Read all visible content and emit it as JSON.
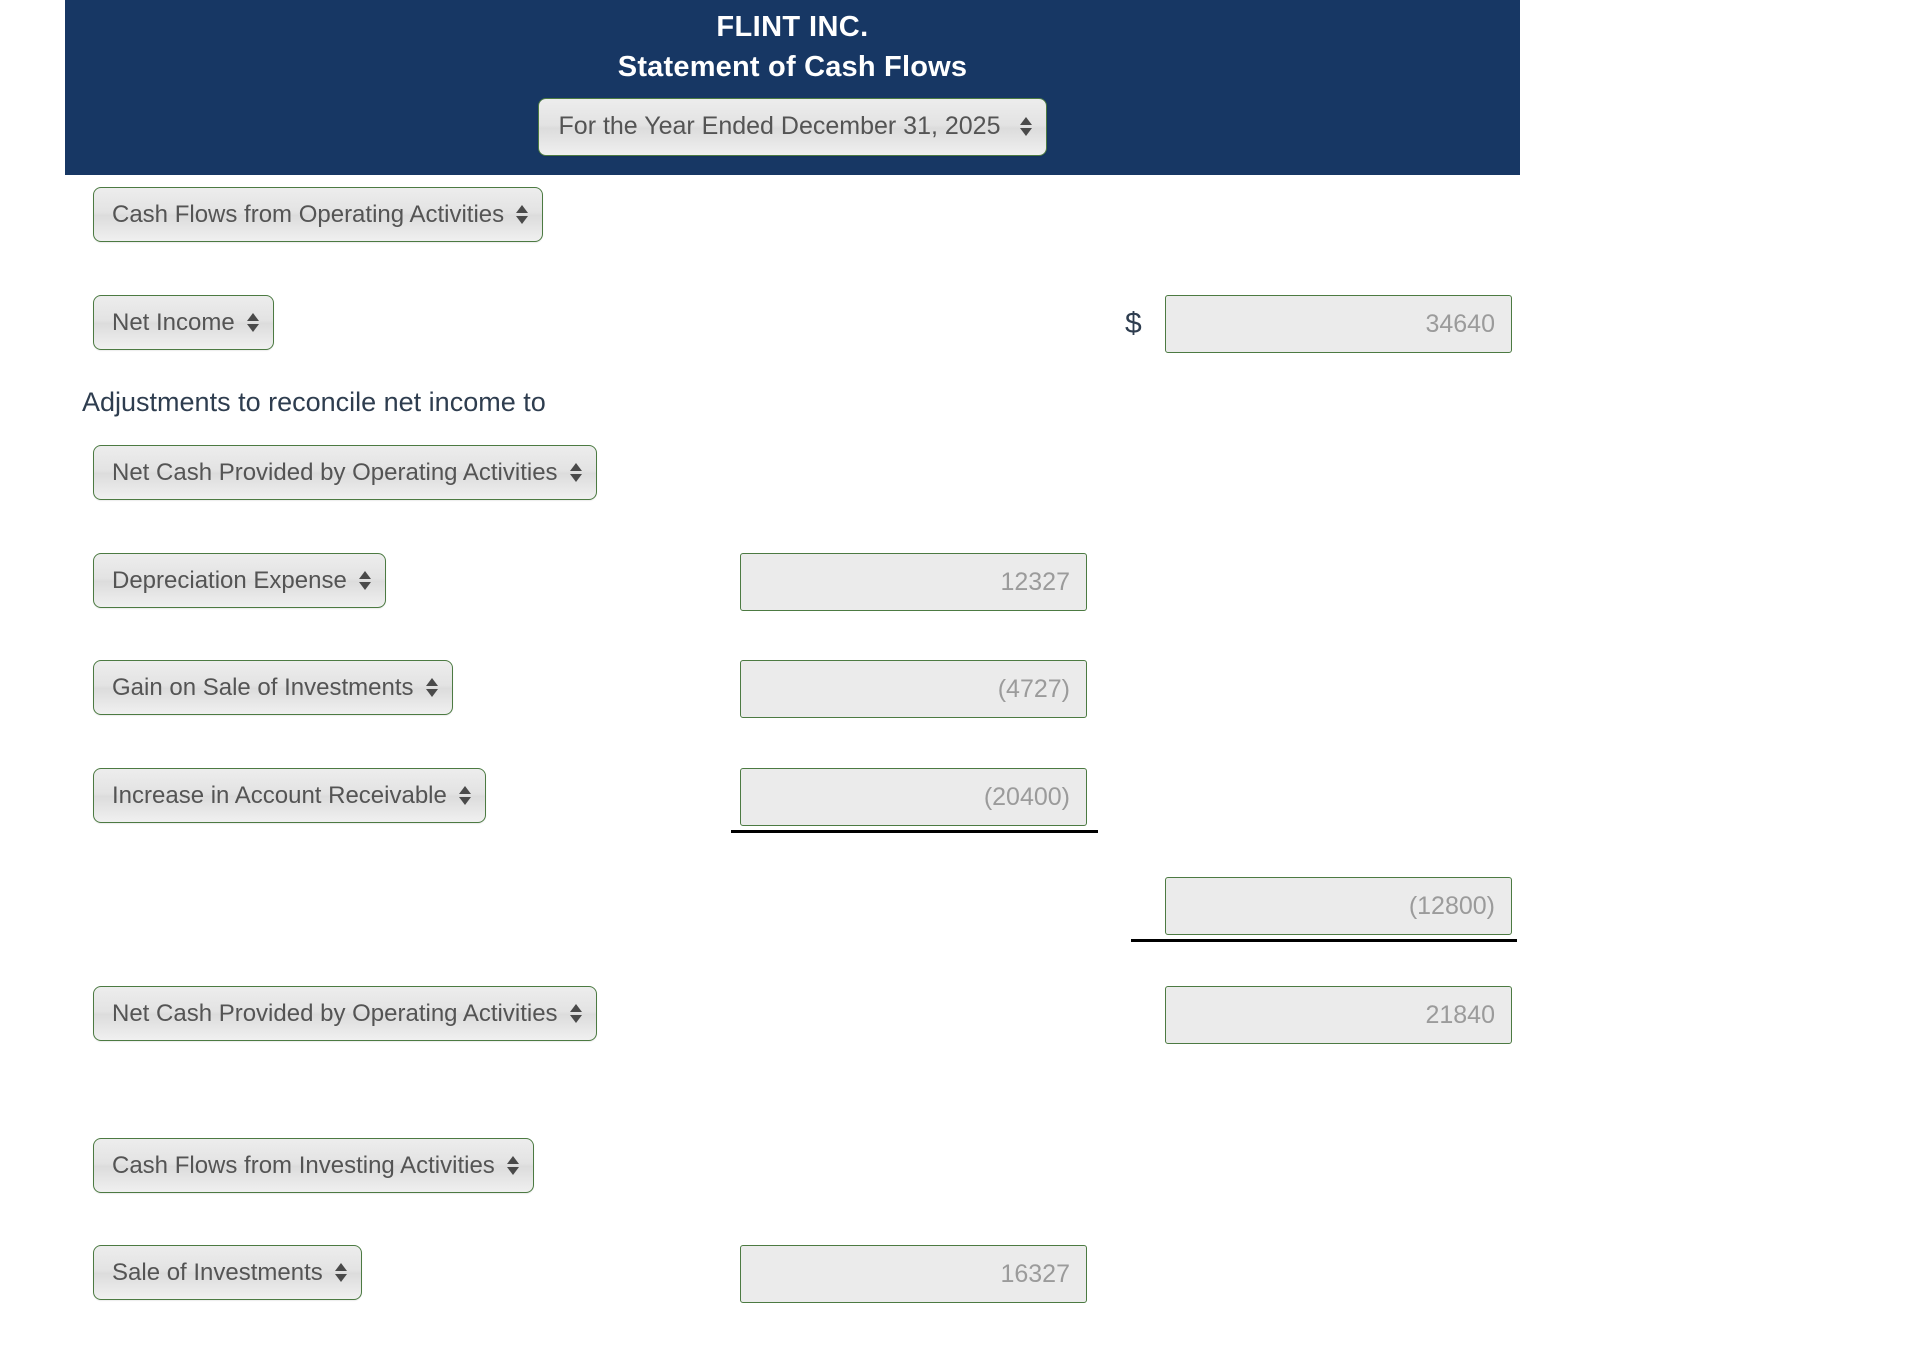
{
  "header": {
    "company": "FLINT INC.",
    "title": "Statement of Cash Flows",
    "period_select": "For the Year Ended December 31, 2025",
    "background_color": "#173764"
  },
  "icons": {
    "spinner": "up-down-arrows-icon",
    "currency": "$"
  },
  "statement": {
    "currency_symbol": "$",
    "rows": [
      {
        "id": "operating-section-heading",
        "type": "select",
        "label": "Cash Flows from Operating Activities"
      },
      {
        "id": "net-income",
        "type": "select-with-right-amount",
        "label": "Net Income",
        "currency": "$",
        "right_amount": "34640"
      },
      {
        "id": "adjustments-note",
        "type": "text",
        "label": "Adjustments to reconcile net income to"
      },
      {
        "id": "adjustments-subheading",
        "type": "select",
        "label": "Net Cash Provided by Operating Activities"
      },
      {
        "id": "depreciation-expense",
        "type": "select-with-mid-amount",
        "label": "Depreciation Expense",
        "mid_amount": "12327"
      },
      {
        "id": "gain-on-sale-of-investments",
        "type": "select-with-mid-amount",
        "label": "Gain on Sale of Investments",
        "mid_amount": "(4727)"
      },
      {
        "id": "increase-in-account-receivable",
        "type": "select-with-mid-amount",
        "label": "Increase in Account Receivable",
        "mid_amount": "(20400)",
        "rule_below": "mid"
      },
      {
        "id": "adjustments-subtotal",
        "type": "amount-right-only",
        "right_amount": "(12800)",
        "rule_below": "right"
      },
      {
        "id": "net-cash-operating",
        "type": "select-with-right-amount",
        "label": "Net Cash Provided by Operating Activities",
        "right_amount": "21840"
      },
      {
        "id": "investing-section-heading",
        "type": "select",
        "label": "Cash Flows from Investing Activities"
      },
      {
        "id": "sale-of-investments",
        "type": "select-with-mid-amount",
        "label": "Sale of Investments",
        "mid_amount": "16327"
      }
    ]
  }
}
